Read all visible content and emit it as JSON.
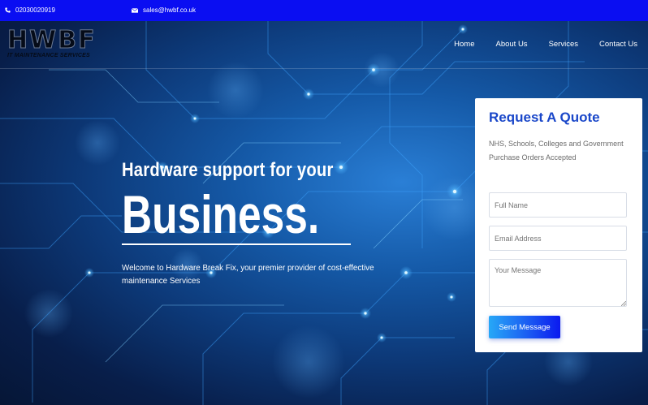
{
  "topbar": {
    "phone": "02030020919",
    "email": "sales@hwbf.co.uk",
    "icons": [
      "phone-icon",
      "envelope-icon"
    ],
    "color": "#0a0ef2"
  },
  "logo": {
    "main": "HWBF",
    "sub": "IT MAINTENANCE SERVICES"
  },
  "nav": {
    "items": [
      "Home",
      "About Us",
      "Services",
      "Contact Us"
    ]
  },
  "hero": {
    "line1": "Hardware support for your",
    "line2": "Business.",
    "welcome": "Welcome to Hardware Break Fix, your premier provider of cost-effective maintenance Services"
  },
  "quote": {
    "title": "Request A Quote",
    "note": "NHS, Schools, Colleges and Government Purchase Orders Accepted",
    "name_placeholder": "Full Name",
    "email_placeholder": "Email Address",
    "message_placeholder": "Your Message",
    "button": "Send Message",
    "title_color": "#1a47c9"
  }
}
